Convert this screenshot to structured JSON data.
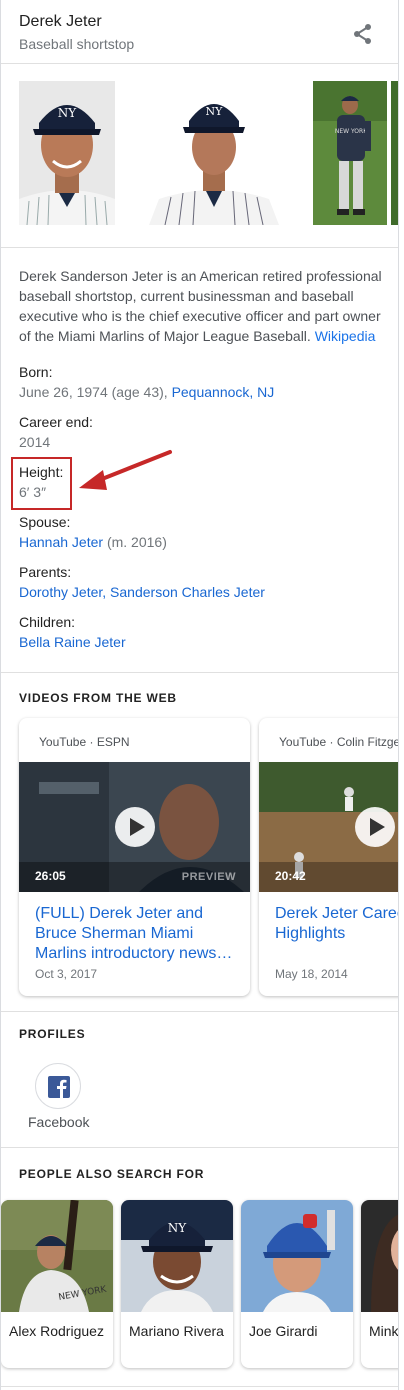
{
  "header": {
    "title": "Derek Jeter",
    "subtitle": "Baseball shortstop"
  },
  "description": {
    "text": "Derek Sanderson Jeter is an American retired professional baseball shortstop, current businessman and baseball executive who is the chief executive officer and part owner of the Miami Marlins of Major League Baseball.",
    "source": "Wikipedia"
  },
  "facts": {
    "born": {
      "label": "Born:",
      "value": "June 26, 1974 (age 43),",
      "place": "Pequannock, NJ"
    },
    "career_end": {
      "label": "Career end:",
      "value": "2014"
    },
    "height": {
      "label": "Height:",
      "value": "6′ 3″"
    },
    "spouse": {
      "label": "Spouse:",
      "name": "Hannah Jeter",
      "detail": "(m. 2016)"
    },
    "parents": {
      "label": "Parents:",
      "first": "Dorothy Jeter,",
      "second": "Sanderson Charles Jeter"
    },
    "children": {
      "label": "Children:",
      "name": "Bella Raine Jeter"
    }
  },
  "videos": {
    "section_title": "VIDEOS FROM THE WEB",
    "items": [
      {
        "source": "YouTube · ESPN",
        "duration": "26:05",
        "badge": "PREVIEW",
        "title": "(FULL) Derek Jeter and Bruce Sherman Miami Marlins introductory news…",
        "date": "Oct 3, 2017"
      },
      {
        "source": "YouTube · Colin Fitzgerald",
        "duration": "20:42",
        "title": "Derek Jeter Career Highlights",
        "date": "May 18, 2014"
      }
    ]
  },
  "profiles": {
    "section_title": "PROFILES",
    "items": [
      {
        "label": "Facebook"
      }
    ]
  },
  "people": {
    "section_title": "PEOPLE ALSO SEARCH FOR",
    "items": [
      {
        "name": "Alex Rodriguez"
      },
      {
        "name": "Mariano Rivera"
      },
      {
        "name": "Joe Girardi"
      },
      {
        "name": "Minka Kelly"
      }
    ]
  },
  "colors": {
    "link": "#1967d2",
    "highlight": "#c62828",
    "facebook": "#3b5998"
  }
}
